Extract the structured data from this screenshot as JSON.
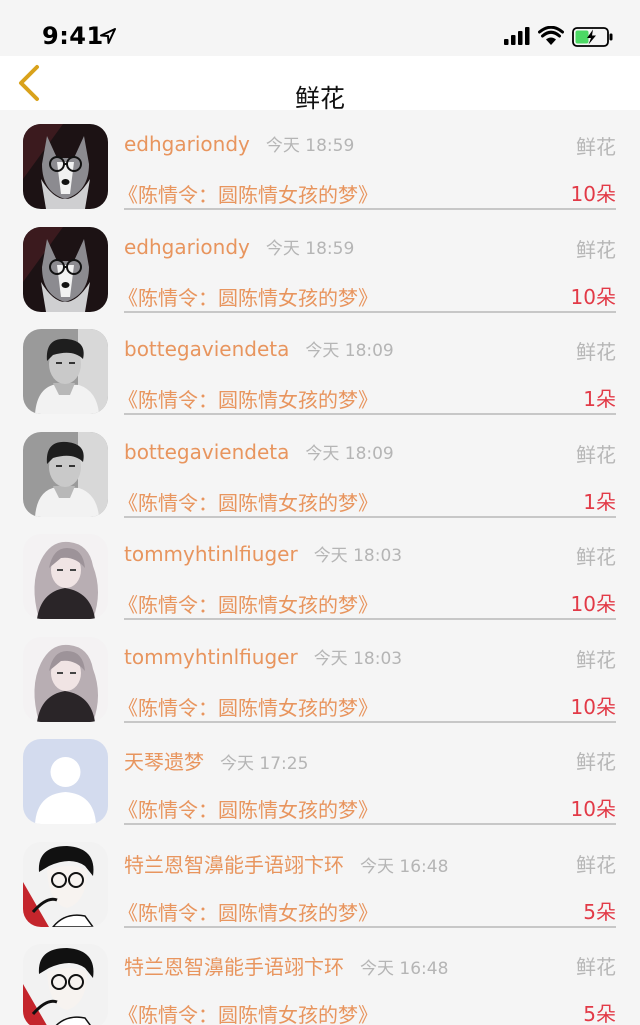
{
  "status_bar": {
    "time": "9:41",
    "icons": [
      "location-arrow-icon",
      "cellular-signal-icon",
      "wifi-icon",
      "battery-charging-icon"
    ]
  },
  "nav": {
    "title": "鲜花",
    "back_icon": "chevron-left-icon"
  },
  "colors": {
    "accent": "#e8955e",
    "count": "#e23a47",
    "back": "#d9a21b",
    "muted": "#b7b7b7"
  },
  "records": [
    {
      "user": "edhgariondy",
      "time": "今天 18:59",
      "gift": "鲜花",
      "book": "《陈情令：圆陈情女孩的梦》",
      "count": "10朵",
      "avatar": "husky-with-glasses"
    },
    {
      "user": "edhgariondy",
      "time": "今天 18:59",
      "gift": "鲜花",
      "book": "《陈情令：圆陈情女孩的梦》",
      "count": "10朵",
      "avatar": "husky-with-glasses"
    },
    {
      "user": "bottegaviendeta",
      "time": "今天 18:09",
      "gift": "鲜花",
      "book": "《陈情令：圆陈情女孩的梦》",
      "count": "1朵",
      "avatar": "monochrome-man-portrait"
    },
    {
      "user": "bottegaviendeta",
      "time": "今天 18:09",
      "gift": "鲜花",
      "book": "《陈情令：圆陈情女孩的梦》",
      "count": "1朵",
      "avatar": "monochrome-man-portrait"
    },
    {
      "user": "tommyhtinlfiuger",
      "time": "今天 18:03",
      "gift": "鲜花",
      "book": "《陈情令：圆陈情女孩的梦》",
      "count": "10朵",
      "avatar": "anime-girl-portrait"
    },
    {
      "user": "tommyhtinlfiuger",
      "time": "今天 18:03",
      "gift": "鲜花",
      "book": "《陈情令：圆陈情女孩的梦》",
      "count": "10朵",
      "avatar": "anime-girl-portrait"
    },
    {
      "user": "天琴遗梦",
      "time": "今天 17:25",
      "gift": "鲜花",
      "book": "《陈情令：圆陈情女孩的梦》",
      "count": "10朵",
      "avatar": "default-person-placeholder"
    },
    {
      "user": "特兰恩智濞能手语翊卞环",
      "time": "今天 16:48",
      "gift": "鲜花",
      "book": "《陈情令：圆陈情女孩的梦》",
      "count": "5朵",
      "avatar": "manga-boy-with-glasses"
    },
    {
      "user": "特兰恩智濞能手语翊卞环",
      "time": "今天 16:48",
      "gift": "鲜花",
      "book": "《陈情令：圆陈情女孩的梦》",
      "count": "5朵",
      "avatar": "manga-boy-with-glasses"
    }
  ]
}
